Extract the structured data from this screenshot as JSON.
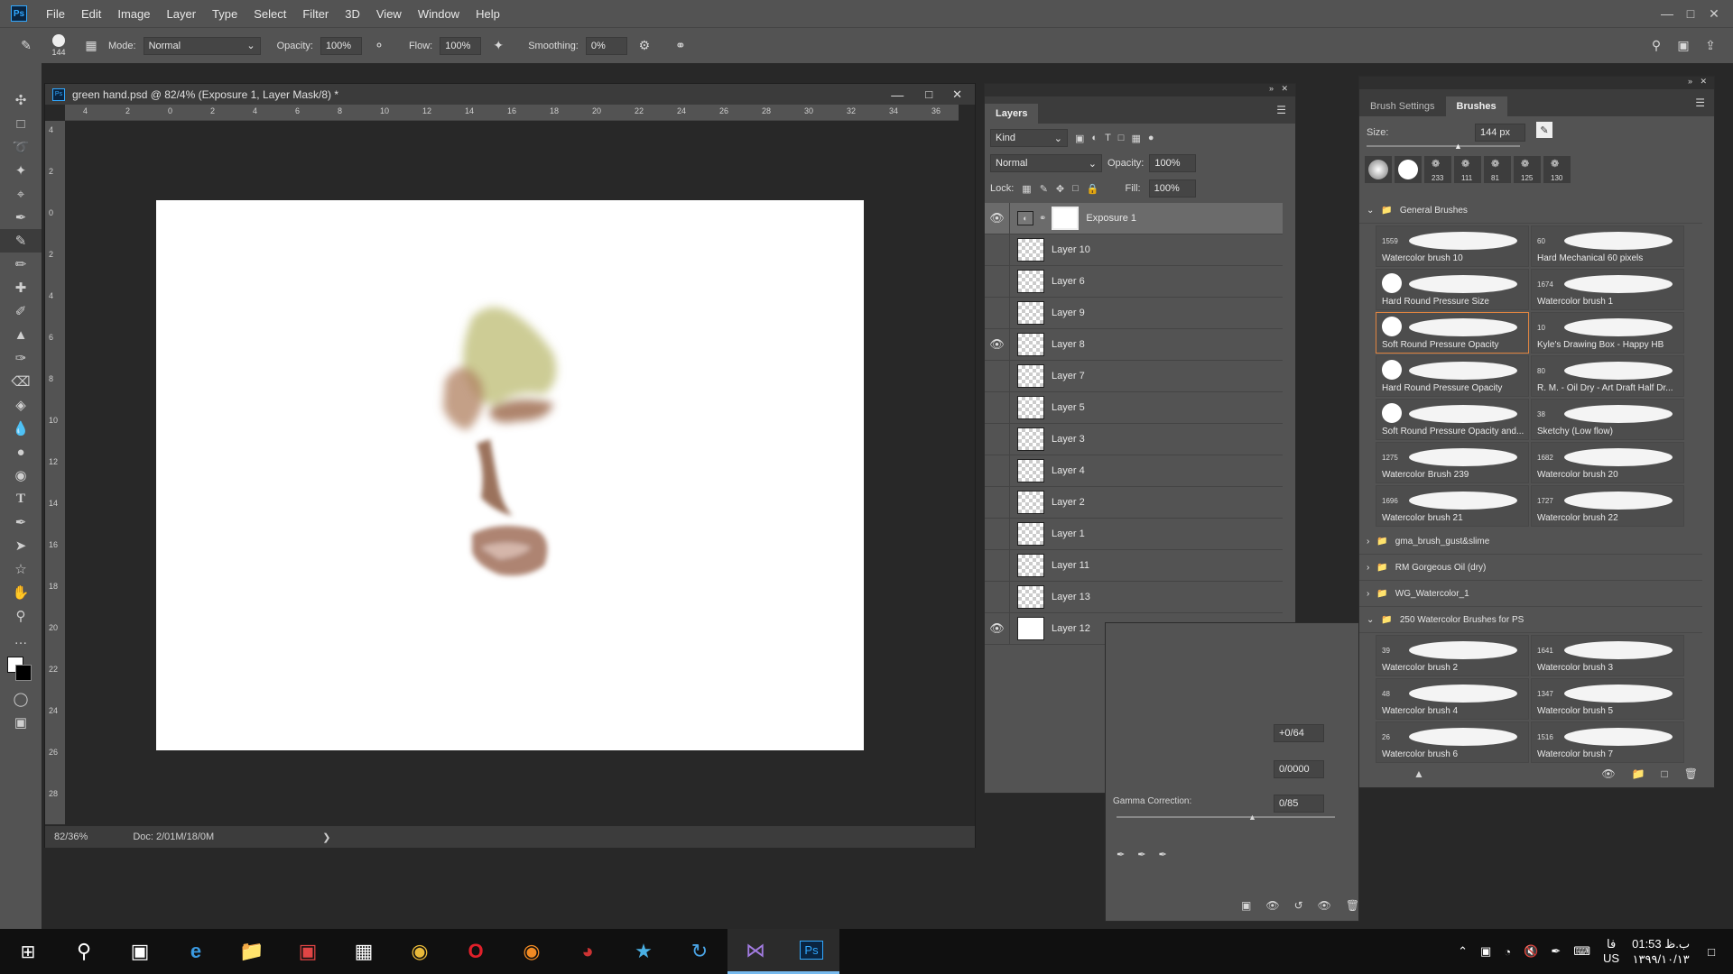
{
  "app": {
    "logo": "Ps"
  },
  "menu": [
    "File",
    "Edit",
    "Image",
    "Layer",
    "Type",
    "Select",
    "Filter",
    "3D",
    "View",
    "Window",
    "Help"
  ],
  "options": {
    "brush_size": "144",
    "mode_label": "Mode:",
    "mode_value": "Normal",
    "opacity_label": "Opacity:",
    "opacity_value": "100%",
    "flow_label": "Flow:",
    "flow_value": "100%",
    "smoothing_label": "Smoothing:",
    "smoothing_value": "0%"
  },
  "document": {
    "tab_title": "green hand.psd @ 82/4% (Exposure 1, Layer Mask/8) *",
    "zoom": "82/36%",
    "doc_info": "Doc: 2/01M/18/0M",
    "ruler_h": [
      "4",
      "2",
      "0",
      "2",
      "4",
      "6",
      "8",
      "10",
      "12",
      "14",
      "16",
      "18",
      "20",
      "22",
      "24",
      "26",
      "28",
      "30",
      "32",
      "34",
      "36"
    ],
    "ruler_v": [
      "4",
      "2",
      "0",
      "2",
      "4",
      "6",
      "8",
      "10",
      "12",
      "14",
      "16",
      "18",
      "20",
      "22",
      "24",
      "26",
      "28"
    ]
  },
  "layers_panel": {
    "tab": "Layers",
    "kind": "Kind",
    "blend_mode": "Normal",
    "opacity_label": "Opacity:",
    "opacity_value": "100%",
    "lock_label": "Lock:",
    "fill_label": "Fill:",
    "fill_value": "100%",
    "layers": [
      {
        "name": "Exposure 1",
        "visible": true
      },
      {
        "name": "Layer 10",
        "visible": false
      },
      {
        "name": "Layer 6",
        "visible": false
      },
      {
        "name": "Layer 9",
        "visible": false
      },
      {
        "name": "Layer 8",
        "visible": true
      },
      {
        "name": "Layer 7",
        "visible": false
      },
      {
        "name": "Layer 5",
        "visible": false
      },
      {
        "name": "Layer 3",
        "visible": false
      },
      {
        "name": "Layer 4",
        "visible": false
      },
      {
        "name": "Layer 2",
        "visible": false
      },
      {
        "name": "Layer 1",
        "visible": false
      },
      {
        "name": "Layer 11",
        "visible": false
      },
      {
        "name": "Layer 13",
        "visible": false
      },
      {
        "name": "Layer 12",
        "visible": true
      }
    ]
  },
  "brushes_panel": {
    "tabs": [
      "Brush Settings",
      "Brushes"
    ],
    "size_label": "Size:",
    "size_value": "144 px",
    "recent_sizes": [
      "233",
      "111",
      "81",
      "125",
      "130"
    ],
    "group1": "General Brushes",
    "brushes": [
      {
        "num": "1559",
        "name": "Watercolor brush 10"
      },
      {
        "num": "60",
        "name": "Hard Mechanical 60 pixels"
      },
      {
        "num": "",
        "name": "Hard Round Pressure Size"
      },
      {
        "num": "1674",
        "name": "Watercolor brush 1"
      },
      {
        "num": "",
        "name": "Soft Round Pressure Opacity"
      },
      {
        "num": "10",
        "name": "Kyle's Drawing Box - Happy HB"
      },
      {
        "num": "",
        "name": "Hard Round Pressure Opacity"
      },
      {
        "num": "80",
        "name": "R. M. - Oil Dry - Art Draft Half Dr..."
      },
      {
        "num": "",
        "name": "Soft Round Pressure Opacity and..."
      },
      {
        "num": "38",
        "name": "Sketchy (Low flow)"
      },
      {
        "num": "1275",
        "name": "Watercolor Brush 239"
      },
      {
        "num": "1682",
        "name": "Watercolor brush 20"
      },
      {
        "num": "1696",
        "name": "Watercolor brush 21"
      },
      {
        "num": "1727",
        "name": "Watercolor brush 22"
      }
    ],
    "folders": [
      "gma_brush_gust&slime",
      "RM Gorgeous Oil (dry)",
      "WG_Watercolor_1",
      "250 Watercolor Brushes for PS"
    ],
    "brushes2": [
      {
        "num": "39",
        "name": "Watercolor brush 2"
      },
      {
        "num": "1641",
        "name": "Watercolor brush 3"
      },
      {
        "num": "48",
        "name": "Watercolor brush 4"
      },
      {
        "num": "1347",
        "name": "Watercolor brush 5"
      },
      {
        "num": "26",
        "name": "Watercolor brush 6"
      },
      {
        "num": "1516",
        "name": "Watercolor brush 7"
      }
    ]
  },
  "properties_panel": {
    "exposure": "+0/64",
    "offset": "0/0000",
    "gamma_label": "Gamma Correction:",
    "gamma_value": "0/85"
  },
  "taskbar": {
    "time": "01:53 ب.ظ",
    "date": "۱۳۹۹/۱۰/۱۳",
    "lang1": "فا",
    "lang2": "US",
    "ps_label": "Ps"
  }
}
